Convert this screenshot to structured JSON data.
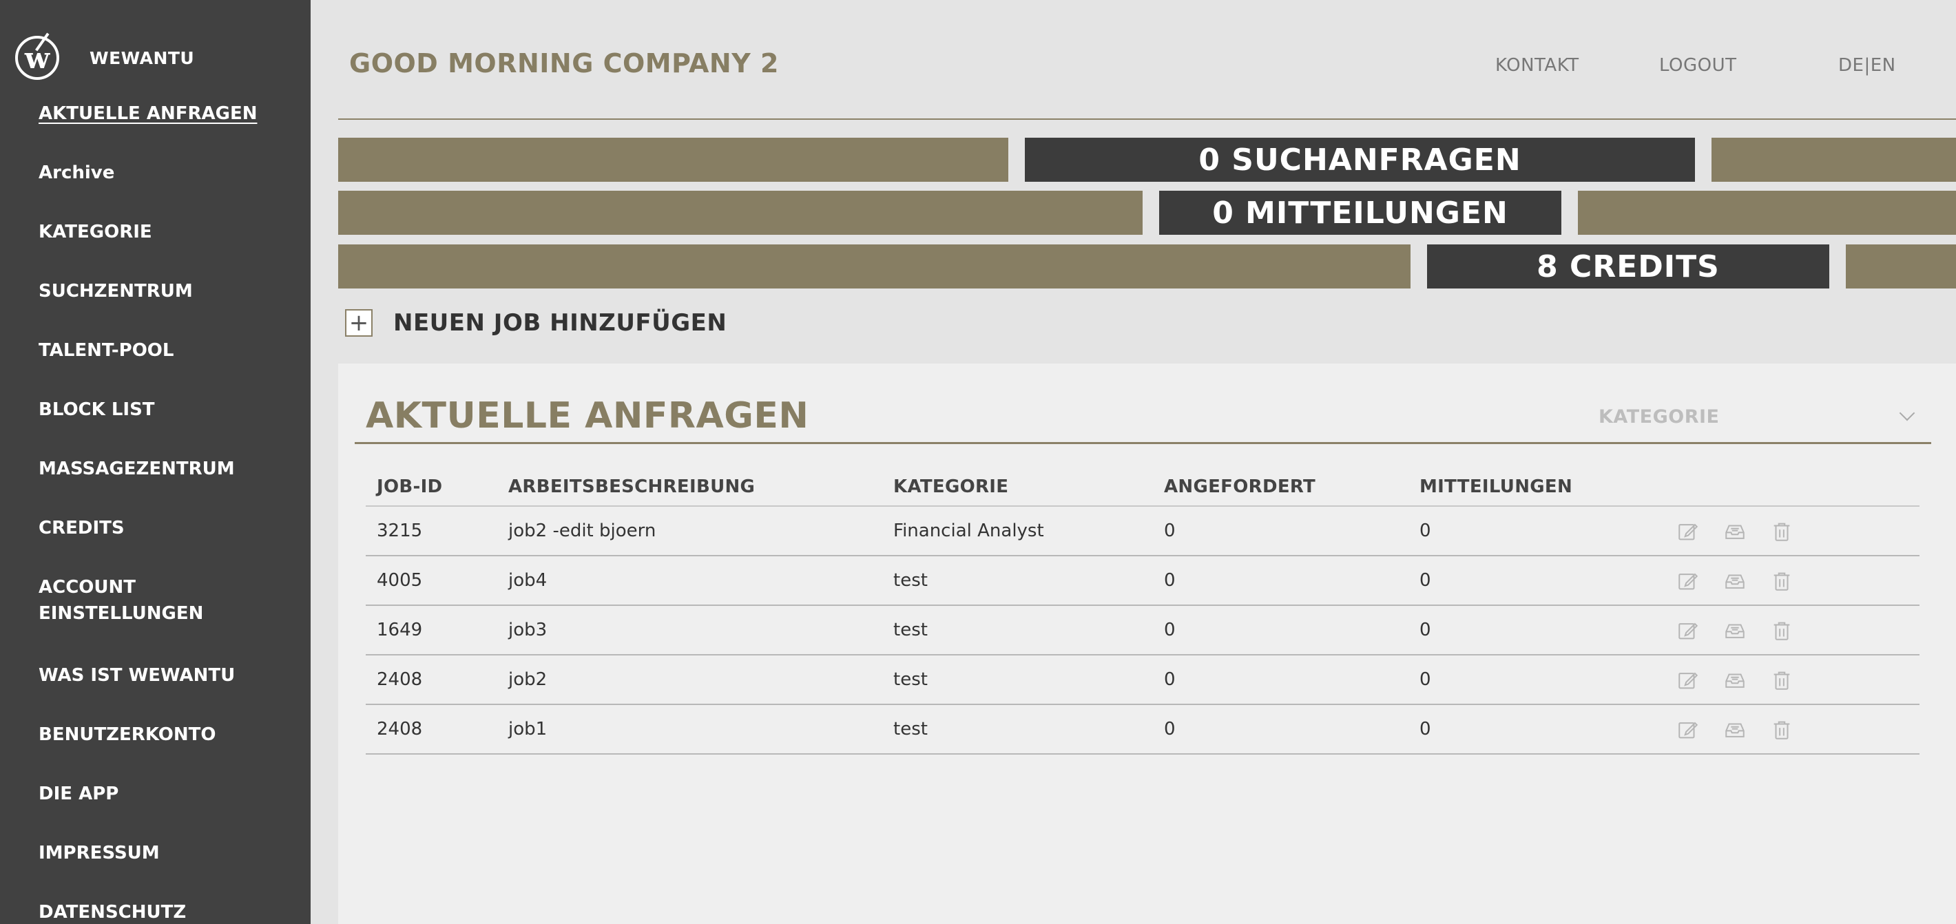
{
  "brand": {
    "logo_letter": "w",
    "name": "WEWANTU"
  },
  "sidebar": {
    "items": [
      {
        "label": "AKTUELLE ANFRAGEN",
        "active": true
      },
      {
        "label": "Archive"
      },
      {
        "label": "KATEGORIE"
      },
      {
        "label": "SUCHZENTRUM"
      },
      {
        "label": "TALENT-POOL"
      },
      {
        "label": "BLOCK LIST"
      },
      {
        "label": "MASSAGEZENTRUM"
      },
      {
        "label": "CREDITS"
      },
      {
        "label": "ACCOUNT EINSTELLUNGEN"
      },
      {
        "label": "WAS IST WEWANTU"
      },
      {
        "label": "BENUTZERKONTO"
      },
      {
        "label": "DIE APP"
      },
      {
        "label": "IMPRESSUM"
      },
      {
        "label": "DATENSCHUTZ"
      }
    ]
  },
  "header": {
    "company": "GOOD MORNING COMPANY 2",
    "kontakt": "KONTAKT",
    "logout": "LOGOUT",
    "lang": "DE|EN"
  },
  "stats": {
    "suchanfragen": "0 SUCHANFRAGEN",
    "mitteilungen": "0 MITTEILUNGEN",
    "credits": "8 CREDITS"
  },
  "add_job": {
    "icon": "+",
    "label": "NEUEN JOB HINZUFÜGEN"
  },
  "panel": {
    "title": "AKTUELLE ANFRAGEN",
    "category_select": "KATEGORIE"
  },
  "table": {
    "headers": [
      "JOB-ID",
      "ARBEITSBESCHREIBUNG",
      "KATEGORIE",
      "ANGEFORDERT",
      "MITTEILUNGEN"
    ],
    "rows": [
      [
        "3215",
        "job2 -edit bjoern",
        "Financial Analyst",
        "0",
        "0"
      ],
      [
        "4005",
        "job4",
        "test",
        "0",
        "0"
      ],
      [
        "1649",
        "job3",
        "test",
        "0",
        "0"
      ],
      [
        "2408",
        "job2",
        "test",
        "0",
        "0"
      ],
      [
        "2408",
        "job1",
        "test",
        "0",
        "0"
      ]
    ],
    "row_actions": [
      "edit-icon",
      "inbox-icon",
      "trash-icon"
    ]
  },
  "colors": {
    "accent": "#877e63",
    "sidebar": "#414141",
    "dark_bar": "#3c3c3c"
  }
}
